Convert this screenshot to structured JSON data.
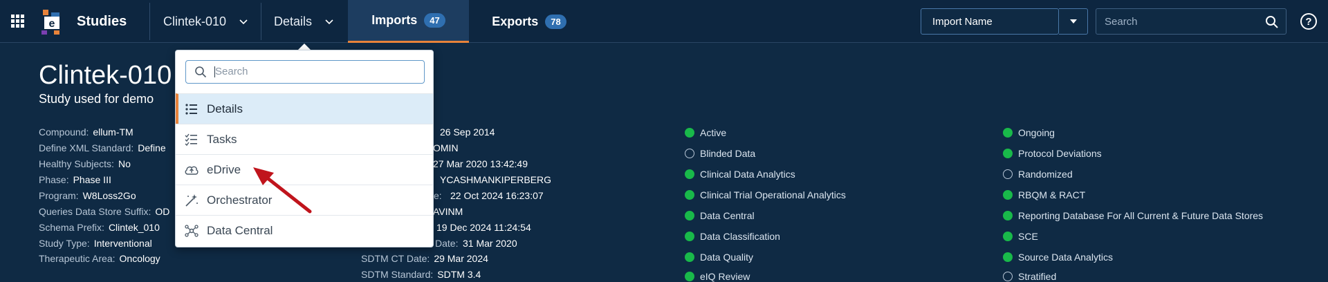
{
  "header": {
    "app_title": "Studies",
    "study_selector": "Clintek-010",
    "section_selector": "Details",
    "tabs": [
      {
        "label": "Imports",
        "count": "47"
      },
      {
        "label": "Exports",
        "count": "78"
      }
    ],
    "import_select_value": "Import Name",
    "search_placeholder": "Search",
    "help_label": "?"
  },
  "study": {
    "title": "Clintek-010",
    "subtitle": "Study used for demo"
  },
  "details_left": [
    {
      "key": "Compound:",
      "value": "ellum-TM"
    },
    {
      "key": "Define XML Standard:",
      "value": "Define"
    },
    {
      "key": "Healthy Subjects:",
      "value": "No"
    },
    {
      "key": "Phase:",
      "value": "Phase III"
    },
    {
      "key": "Program:",
      "value": "W8Loss2Go"
    },
    {
      "key": "Queries Data Store Suffix:",
      "value": "OD"
    },
    {
      "key": "Schema Prefix:",
      "value": "Clintek_010"
    },
    {
      "key": "Study Type:",
      "value": "Interventional"
    },
    {
      "key": "Therapeutic Area:",
      "value": "Oncology"
    }
  ],
  "details_middle": {
    "partial_values": [
      "26 Sep 2014",
      "OMIN",
      "27 Mar 2020 13:42:49",
      "YCASHMANKIPERBERG",
      "e:",
      "22 Oct 2024 16:23:07",
      "AVINM",
      "19 Dec 2024 11:24:54",
      "Date:",
      "31 Mar 2020"
    ],
    "rows": [
      {
        "key": "SDTM CT Date:",
        "value": "29 Mar 2024"
      },
      {
        "key": "SDTM Standard:",
        "value": "SDTM 3.4"
      }
    ]
  },
  "features_col1": [
    {
      "label": "Active",
      "enabled": true
    },
    {
      "label": "Blinded Data",
      "enabled": false
    },
    {
      "label": "Clinical Data Analytics",
      "enabled": true
    },
    {
      "label": "Clinical Trial Operational Analytics",
      "enabled": true
    },
    {
      "label": "Data Central",
      "enabled": true
    },
    {
      "label": "Data Classification",
      "enabled": true
    },
    {
      "label": "Data Quality",
      "enabled": true
    },
    {
      "label": "eIQ Review",
      "enabled": true
    }
  ],
  "features_col2": [
    {
      "label": "Ongoing",
      "enabled": true
    },
    {
      "label": "Protocol Deviations",
      "enabled": true
    },
    {
      "label": "Randomized",
      "enabled": false
    },
    {
      "label": "RBQM & RACT",
      "enabled": true
    },
    {
      "label": "Reporting Database For All Current & Future Data Stores",
      "enabled": true
    },
    {
      "label": "SCE",
      "enabled": true
    },
    {
      "label": "Source Data Analytics",
      "enabled": true
    },
    {
      "label": "Stratified",
      "enabled": false
    }
  ],
  "dropdown": {
    "search_placeholder": "Search",
    "items": [
      {
        "label": "Details",
        "icon": "list-icon",
        "selected": true
      },
      {
        "label": "Tasks",
        "icon": "checklist-icon",
        "selected": false
      },
      {
        "label": "eDrive",
        "icon": "cloud-upload-icon",
        "selected": false
      },
      {
        "label": "Orchestrator",
        "icon": "magic-wand-icon",
        "selected": false
      },
      {
        "label": "Data Central",
        "icon": "network-icon",
        "selected": false
      }
    ]
  },
  "colors": {
    "background": "#0f2a44",
    "topbar": "#0d2640",
    "accent_orange": "#e8833a",
    "badge_blue": "#2f6fb0",
    "status_green": "#19b94a",
    "arrow_red": "#c0141c"
  }
}
